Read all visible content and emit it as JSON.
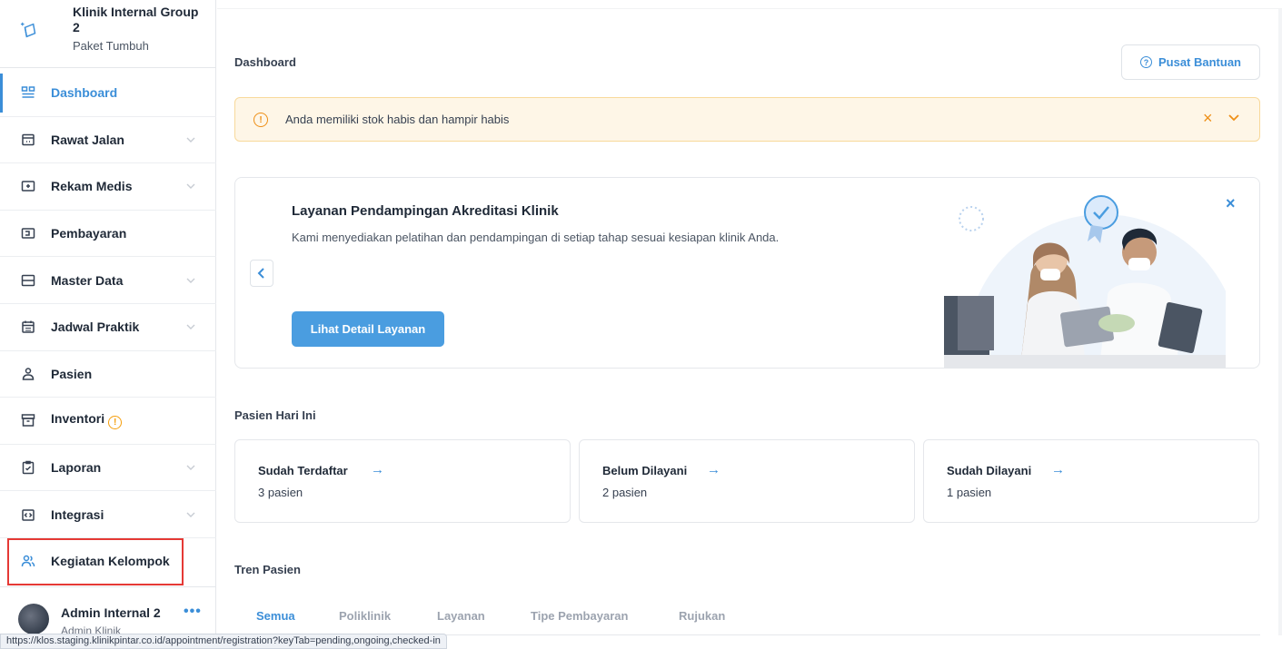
{
  "org": {
    "name": "Klinik Internal Group 2",
    "plan": "Paket Tumbuh",
    "logo_icon": "book-sparkle-icon"
  },
  "sidebar": {
    "items": [
      {
        "label": "Dashboard",
        "icon": "dashboard-icon",
        "active": true,
        "has_chevron": false
      },
      {
        "label": "Rawat Jalan",
        "icon": "calendar-clinic-icon",
        "has_chevron": true
      },
      {
        "label": "Rekam Medis",
        "icon": "medical-folder-icon",
        "has_chevron": true
      },
      {
        "label": "Pembayaran",
        "icon": "payment-icon",
        "has_chevron": false
      },
      {
        "label": "Master Data",
        "icon": "database-icon",
        "has_chevron": true
      },
      {
        "label": "Jadwal Praktik",
        "icon": "schedule-icon",
        "has_chevron": true
      },
      {
        "label": "Pasien",
        "icon": "patient-icon",
        "has_chevron": false
      },
      {
        "label": "Inventori",
        "icon": "inventory-icon",
        "has_chevron": false,
        "warning": "!"
      },
      {
        "label": "Laporan",
        "icon": "report-icon",
        "has_chevron": true
      },
      {
        "label": "Integrasi",
        "icon": "integration-icon",
        "has_chevron": true
      },
      {
        "label": "Kegiatan Kelompok",
        "icon": "group-icon",
        "has_chevron": false,
        "highlighted": true
      }
    ]
  },
  "user": {
    "name": "Admin Internal 2",
    "role": "Admin Klinik",
    "more": "•••"
  },
  "status_url": "https://klos.staging.klinikpintar.co.id/appointment/registration?keyTab=pending,ongoing,checked-in",
  "header": {
    "title": "Dashboard",
    "help_label": "Pusat Bantuan",
    "help_icon": "?"
  },
  "alert": {
    "text": "Anda memiliki stok habis dan hampir habis",
    "icon": "!",
    "close": "×"
  },
  "promo": {
    "title": "Layanan Pendampingan Akreditasi Klinik",
    "description": "Kami menyediakan pelatihan dan pendampingan di setiap tahap sesuai kesiapan klinik Anda.",
    "cta": "Lihat Detail Layanan",
    "close": "×"
  },
  "patients_today": {
    "title": "Pasien Hari Ini",
    "cards": [
      {
        "label": "Sudah Terdaftar",
        "value": "3 pasien"
      },
      {
        "label": "Belum Dilayani",
        "value": "2 pasien"
      },
      {
        "label": "Sudah Dilayani",
        "value": "1 pasien"
      }
    ],
    "arrow": "→"
  },
  "trend": {
    "title": "Tren Pasien",
    "tabs": [
      "Semua",
      "Poliklinik",
      "Layanan",
      "Tipe Pembayaran",
      "Rujukan"
    ],
    "active_tab": "Semua"
  },
  "colors": {
    "accent": "#3b8ed8",
    "warning": "#ee8f16",
    "alert_bg": "#fef6e7",
    "highlight_border": "#e53935"
  }
}
